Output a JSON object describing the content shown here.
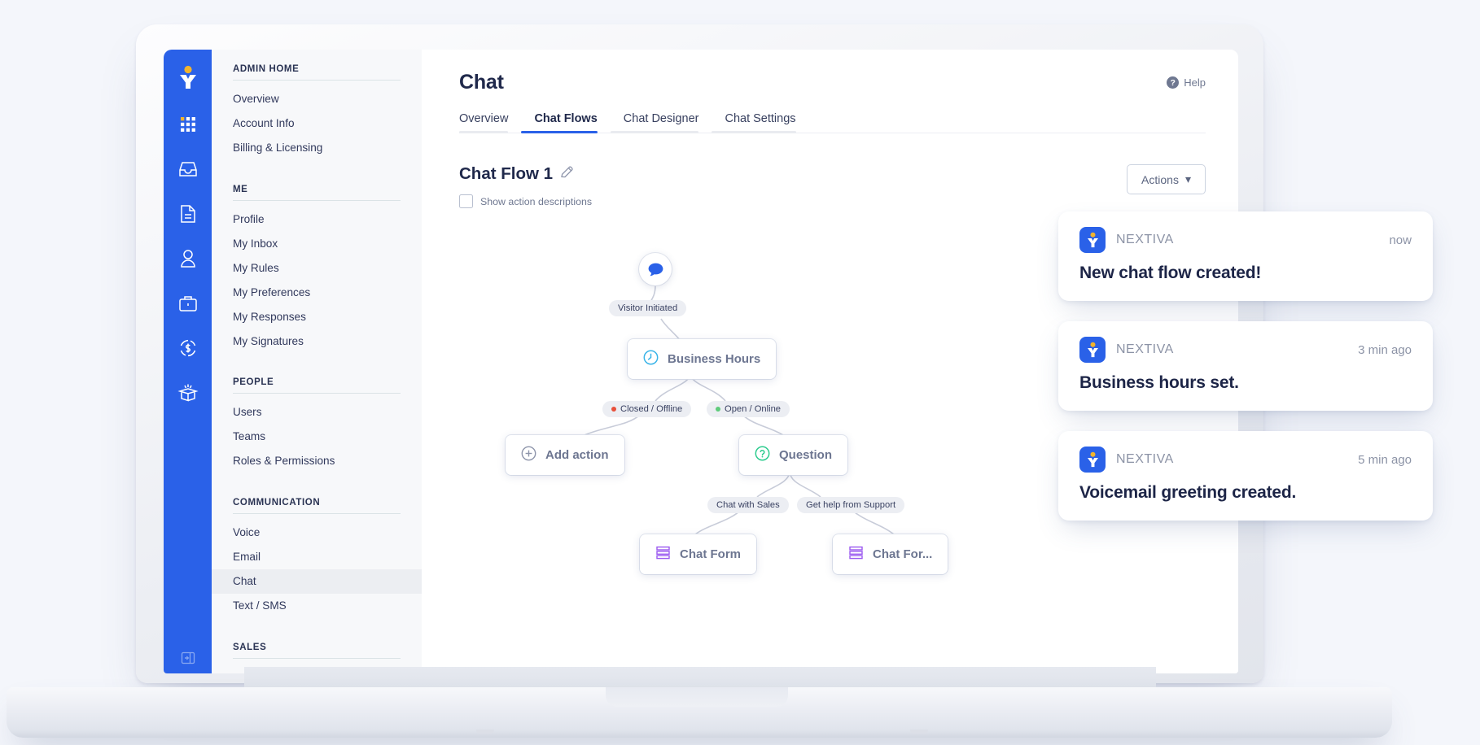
{
  "rail": {
    "logo_icon": "nextiva-logo-icon",
    "icons": [
      {
        "name": "apps-grid-icon"
      },
      {
        "name": "inbox-icon"
      },
      {
        "name": "document-icon"
      },
      {
        "name": "user-icon"
      },
      {
        "name": "briefcase-icon"
      },
      {
        "name": "dollar-refresh-icon"
      },
      {
        "name": "gift-box-icon"
      }
    ],
    "collapse_icon": "collapse-panel-icon"
  },
  "sidebar": {
    "sections": [
      {
        "heading": "ADMIN HOME",
        "items": [
          {
            "label": "Overview",
            "active": false
          },
          {
            "label": "Account Info",
            "active": false
          },
          {
            "label": "Billing & Licensing",
            "active": false
          }
        ]
      },
      {
        "heading": "ME",
        "items": [
          {
            "label": "Profile",
            "active": false
          },
          {
            "label": "My Inbox",
            "active": false
          },
          {
            "label": "My Rules",
            "active": false
          },
          {
            "label": "My Preferences",
            "active": false
          },
          {
            "label": "My Responses",
            "active": false
          },
          {
            "label": "My Signatures",
            "active": false
          }
        ]
      },
      {
        "heading": "PEOPLE",
        "items": [
          {
            "label": "Users",
            "active": false
          },
          {
            "label": "Teams",
            "active": false
          },
          {
            "label": "Roles & Permissions",
            "active": false
          }
        ]
      },
      {
        "heading": "COMMUNICATION",
        "items": [
          {
            "label": "Voice",
            "active": false
          },
          {
            "label": "Email",
            "active": false
          },
          {
            "label": "Chat",
            "active": true
          },
          {
            "label": "Text / SMS",
            "active": false
          }
        ]
      },
      {
        "heading": "SALES",
        "items": []
      }
    ]
  },
  "header": {
    "title": "Chat",
    "help_label": "Help",
    "help_icon": "question-mark-icon"
  },
  "tabs": [
    {
      "label": "Overview",
      "active": false
    },
    {
      "label": "Chat Flows",
      "active": true
    },
    {
      "label": "Chat Designer",
      "active": false
    },
    {
      "label": "Chat Settings",
      "active": false
    }
  ],
  "flow_header": {
    "title": "Chat Flow 1",
    "edit_icon": "pencil-icon",
    "checkbox_label": "Show action descriptions",
    "checkbox_checked": false,
    "actions_label": "Actions",
    "actions_caret": "▾"
  },
  "flow": {
    "start_node": {
      "icon": "chat-bubble-icon",
      "color": "#2a61e8"
    },
    "nodes": [
      {
        "id": "business-hours",
        "label": "Business Hours",
        "icon": "clock-icon",
        "icon_color": "#3ab4e8"
      },
      {
        "id": "add-action",
        "label": "Add action",
        "icon": "plus-circle-icon",
        "icon_color": "#8d94aa"
      },
      {
        "id": "question",
        "label": "Question",
        "icon": "question-circle-icon",
        "icon_color": "#2ecc8f"
      },
      {
        "id": "chat-form-left",
        "label": "Chat Form",
        "icon": "form-lines-icon",
        "icon_color": "#9b59f0"
      },
      {
        "id": "chat-form-right",
        "label": "Chat For...",
        "icon": "form-lines-icon",
        "icon_color": "#9b59f0"
      }
    ],
    "chips": [
      {
        "id": "visitor-initiated",
        "label": "Visitor Initiated",
        "dot": null
      },
      {
        "id": "closed-offline",
        "label": "Closed / Offline",
        "dot": "#e8503a"
      },
      {
        "id": "open-online",
        "label": "Open / Online",
        "dot": "#5ecb7b"
      },
      {
        "id": "chat-with-sales",
        "label": "Chat with Sales",
        "dot": null
      },
      {
        "id": "get-help-from-support",
        "label": "Get help from Support",
        "dot": null
      }
    ]
  },
  "notifications": [
    {
      "brand": "NEXTIVA",
      "time": "now",
      "message": "New chat flow created!"
    },
    {
      "brand": "NEXTIVA",
      "time": "3 min ago",
      "message": "Business hours set."
    },
    {
      "brand": "NEXTIVA",
      "time": "5 min ago",
      "message": "Voicemail greeting created."
    }
  ],
  "colors": {
    "brand_blue": "#2a61e8",
    "page_bg": "#f4f6fb",
    "sidebar_bg": "#f7f8fa",
    "text_dark": "#20294b",
    "muted": "#6f7891"
  }
}
